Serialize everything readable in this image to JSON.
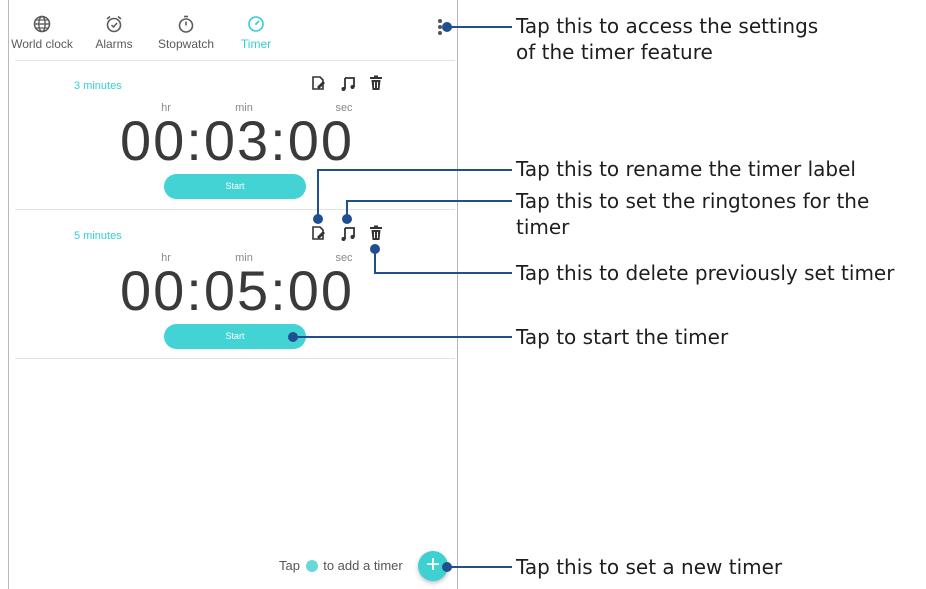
{
  "tabs": [
    {
      "label": "World clock",
      "icon": "globe-icon"
    },
    {
      "label": "Alarms",
      "icon": "alarm-icon"
    },
    {
      "label": "Stopwatch",
      "icon": "stopwatch-icon"
    },
    {
      "label": "Timer",
      "icon": "timer-icon",
      "active": true
    }
  ],
  "timers": [
    {
      "label": "3 minutes",
      "units": {
        "hr": "hr",
        "min": "min",
        "sec": "sec"
      },
      "time": "00:03:00",
      "start": "Start"
    },
    {
      "label": "5 minutes",
      "units": {
        "hr": "hr",
        "min": "min",
        "sec": "sec"
      },
      "time": "00:05:00",
      "start": "Start"
    }
  ],
  "hint": {
    "before": "Tap",
    "after": "to add a timer"
  },
  "fab": {
    "symbol": "+"
  },
  "callouts": {
    "settings_line1": "Tap this to access the settings",
    "settings_line2": "of the timer feature",
    "rename": "Tap this to rename the timer label",
    "ringtone": "Tap this to set the ringtones for the timer",
    "delete": "Tap this to delete previously set timer",
    "start": "Tap to start the timer",
    "new": "Tap this to set a new timer"
  },
  "colors": {
    "accent": "#33cfd2",
    "callout_line": "#1f4f8f"
  }
}
